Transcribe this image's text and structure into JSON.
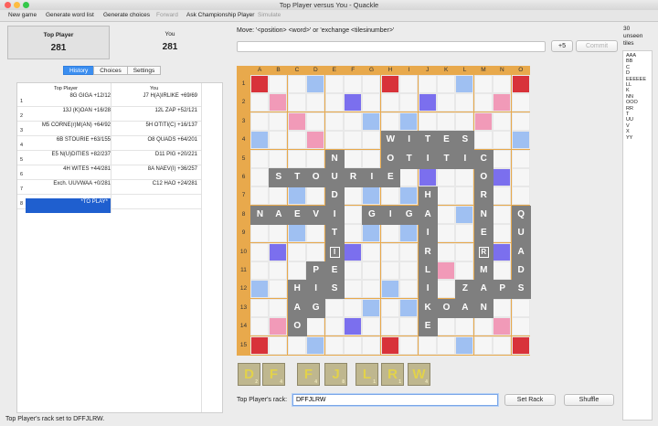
{
  "window": {
    "title": "Top Player versus You - Quackle"
  },
  "toolbar": {
    "new_game": "New game",
    "generate_word_list": "Generate word list",
    "generate_choices": "Generate choices",
    "forward": "Forward",
    "ask_championship": "Ask Championship Player",
    "simulate": "Simulate"
  },
  "scores": {
    "p1_name": "Top Player",
    "p1_score": "281",
    "p2_name": "You",
    "p2_score": "281"
  },
  "tabs": {
    "history": "History",
    "choices": "Choices",
    "settings": "Settings"
  },
  "history": {
    "col1": "Top Player",
    "col2": "You",
    "rows": [
      {
        "n": "1",
        "p1": "8G GIGA  +12/12",
        "p2": "J7 H(A)IRLIKE  +69/69"
      },
      {
        "n": "2",
        "p1": "13J (K)OAN  +16/28",
        "p2": "12L ZAP  +52/121"
      },
      {
        "n": "3",
        "p1": "M5 CORNE(r)M(AN)  +64/92",
        "p2": "5H OTITI(C)  +16/137"
      },
      {
        "n": "4",
        "p1": "6B STOURIE  +63/155",
        "p2": "O8 QUADS  +64/201"
      },
      {
        "n": "5",
        "p1": "E5 N(U)DITIES  +82/237",
        "p2": "D11 PIG  +20/221"
      },
      {
        "n": "6",
        "p1": "4H WITES  +44/281",
        "p2": "8A NAEV(I)  +36/257"
      },
      {
        "n": "7",
        "p1": "Exch. UUVWAA  +0/281",
        "p2": "C12 HAO  +24/281"
      },
      {
        "n": "8",
        "p1": "*TO PLAY*",
        "p2": ""
      }
    ]
  },
  "status": "Top Player's rack set to DFFJLRW.",
  "move": {
    "label": "Move: '<position> <word>' or 'exchange <tilesinumber>'",
    "value": "",
    "plus5": "+5",
    "commit": "Commit"
  },
  "unseen": {
    "label_count": "30",
    "label_word": "unseen",
    "label_tiles": "tiles",
    "lines": [
      "AAA",
      "BB",
      "C",
      "D",
      "EEEEEE",
      "LL",
      "K",
      "NN",
      "OOO",
      "RR",
      "T",
      "UU",
      "V",
      "X",
      "YY"
    ]
  },
  "board": {
    "columns": [
      "A",
      "B",
      "C",
      "D",
      "E",
      "F",
      "G",
      "H",
      "I",
      "J",
      "K",
      "L",
      "M",
      "N",
      "O"
    ],
    "rows": [
      "1",
      "2",
      "3",
      "4",
      "5",
      "6",
      "7",
      "8",
      "9",
      "10",
      "11",
      "12",
      "13",
      "14",
      "15"
    ],
    "colors": {
      "TW": "#d8323a",
      "DW": "#f19ab8",
      "TL": "#7b6fee",
      "DL": "#9fc0f2",
      "plain": "#f6f6f6",
      "tile": "#7f7f7f"
    },
    "premium": {
      "TW": [
        [
          0,
          0
        ],
        [
          0,
          7
        ],
        [
          0,
          14
        ],
        [
          7,
          0
        ],
        [
          7,
          14
        ],
        [
          14,
          0
        ],
        [
          14,
          7
        ],
        [
          14,
          14
        ]
      ],
      "DW": [
        [
          1,
          1
        ],
        [
          2,
          2
        ],
        [
          3,
          3
        ],
        [
          4,
          4
        ],
        [
          1,
          13
        ],
        [
          2,
          12
        ],
        [
          3,
          11
        ],
        [
          4,
          10
        ],
        [
          10,
          4
        ],
        [
          11,
          3
        ],
        [
          12,
          2
        ],
        [
          13,
          1
        ],
        [
          10,
          10
        ],
        [
          11,
          11
        ],
        [
          12,
          12
        ],
        [
          13,
          13
        ]
      ],
      "TL": [
        [
          1,
          5
        ],
        [
          1,
          9
        ],
        [
          5,
          1
        ],
        [
          5,
          5
        ],
        [
          5,
          9
        ],
        [
          5,
          13
        ],
        [
          9,
          1
        ],
        [
          9,
          5
        ],
        [
          9,
          9
        ],
        [
          9,
          13
        ],
        [
          13,
          5
        ],
        [
          13,
          9
        ]
      ],
      "DL": [
        [
          0,
          3
        ],
        [
          0,
          11
        ],
        [
          2,
          6
        ],
        [
          2,
          8
        ],
        [
          3,
          0
        ],
        [
          3,
          7
        ],
        [
          3,
          14
        ],
        [
          6,
          2
        ],
        [
          6,
          6
        ],
        [
          6,
          8
        ],
        [
          6,
          12
        ],
        [
          7,
          3
        ],
        [
          7,
          11
        ],
        [
          8,
          2
        ],
        [
          8,
          6
        ],
        [
          8,
          8
        ],
        [
          8,
          12
        ],
        [
          11,
          0
        ],
        [
          11,
          7
        ],
        [
          11,
          14
        ],
        [
          12,
          6
        ],
        [
          12,
          8
        ],
        [
          14,
          3
        ],
        [
          14,
          11
        ]
      ]
    },
    "tiles": [
      {
        "r": 3,
        "c": 7,
        "ch": "W"
      },
      {
        "r": 3,
        "c": 8,
        "ch": "I"
      },
      {
        "r": 3,
        "c": 9,
        "ch": "T"
      },
      {
        "r": 3,
        "c": 10,
        "ch": "E"
      },
      {
        "r": 3,
        "c": 11,
        "ch": "S"
      },
      {
        "r": 4,
        "c": 4,
        "ch": "N"
      },
      {
        "r": 4,
        "c": 7,
        "ch": "O"
      },
      {
        "r": 4,
        "c": 8,
        "ch": "T"
      },
      {
        "r": 4,
        "c": 9,
        "ch": "I"
      },
      {
        "r": 4,
        "c": 10,
        "ch": "T"
      },
      {
        "r": 4,
        "c": 11,
        "ch": "I"
      },
      {
        "r": 4,
        "c": 12,
        "ch": "C"
      },
      {
        "r": 5,
        "c": 1,
        "ch": "S"
      },
      {
        "r": 5,
        "c": 2,
        "ch": "T"
      },
      {
        "r": 5,
        "c": 3,
        "ch": "O"
      },
      {
        "r": 5,
        "c": 4,
        "ch": "U"
      },
      {
        "r": 5,
        "c": 5,
        "ch": "R"
      },
      {
        "r": 5,
        "c": 6,
        "ch": "I"
      },
      {
        "r": 5,
        "c": 7,
        "ch": "E"
      },
      {
        "r": 5,
        "c": 12,
        "ch": "O"
      },
      {
        "r": 6,
        "c": 4,
        "ch": "D"
      },
      {
        "r": 6,
        "c": 9,
        "ch": "H"
      },
      {
        "r": 6,
        "c": 12,
        "ch": "R"
      },
      {
        "r": 7,
        "c": 0,
        "ch": "N"
      },
      {
        "r": 7,
        "c": 1,
        "ch": "A"
      },
      {
        "r": 7,
        "c": 2,
        "ch": "E"
      },
      {
        "r": 7,
        "c": 3,
        "ch": "V"
      },
      {
        "r": 7,
        "c": 4,
        "ch": "I"
      },
      {
        "r": 7,
        "c": 6,
        "ch": "G"
      },
      {
        "r": 7,
        "c": 7,
        "ch": "I"
      },
      {
        "r": 7,
        "c": 8,
        "ch": "G"
      },
      {
        "r": 7,
        "c": 9,
        "ch": "A"
      },
      {
        "r": 7,
        "c": 12,
        "ch": "N"
      },
      {
        "r": 7,
        "c": 14,
        "ch": "Q"
      },
      {
        "r": 8,
        "c": 4,
        "ch": "T"
      },
      {
        "r": 8,
        "c": 9,
        "ch": "I"
      },
      {
        "r": 8,
        "c": 12,
        "ch": "E"
      },
      {
        "r": 8,
        "c": 14,
        "ch": "U"
      },
      {
        "r": 9,
        "c": 4,
        "ch": "I",
        "blank": true
      },
      {
        "r": 9,
        "c": 9,
        "ch": "R"
      },
      {
        "r": 9,
        "c": 12,
        "ch": "R",
        "blank": true
      },
      {
        "r": 9,
        "c": 14,
        "ch": "A"
      },
      {
        "r": 10,
        "c": 3,
        "ch": "P"
      },
      {
        "r": 10,
        "c": 4,
        "ch": "E"
      },
      {
        "r": 10,
        "c": 9,
        "ch": "L"
      },
      {
        "r": 10,
        "c": 12,
        "ch": "M"
      },
      {
        "r": 10,
        "c": 14,
        "ch": "D"
      },
      {
        "r": 11,
        "c": 2,
        "ch": "H"
      },
      {
        "r": 11,
        "c": 3,
        "ch": "I"
      },
      {
        "r": 11,
        "c": 4,
        "ch": "S"
      },
      {
        "r": 11,
        "c": 9,
        "ch": "I"
      },
      {
        "r": 11,
        "c": 11,
        "ch": "Z"
      },
      {
        "r": 11,
        "c": 12,
        "ch": "A"
      },
      {
        "r": 11,
        "c": 13,
        "ch": "P"
      },
      {
        "r": 11,
        "c": 14,
        "ch": "S"
      },
      {
        "r": 12,
        "c": 2,
        "ch": "A"
      },
      {
        "r": 12,
        "c": 3,
        "ch": "G"
      },
      {
        "r": 12,
        "c": 9,
        "ch": "K"
      },
      {
        "r": 12,
        "c": 10,
        "ch": "O"
      },
      {
        "r": 12,
        "c": 11,
        "ch": "A"
      },
      {
        "r": 12,
        "c": 12,
        "ch": "N"
      },
      {
        "r": 13,
        "c": 2,
        "ch": "O"
      },
      {
        "r": 13,
        "c": 9,
        "ch": "E"
      }
    ]
  },
  "rack": {
    "tiles": [
      {
        "ch": "D",
        "v": "2"
      },
      {
        "ch": "F",
        "v": "4"
      },
      {
        "ch": "F",
        "v": "4"
      },
      {
        "ch": "J",
        "v": "8"
      },
      {
        "ch": "L",
        "v": "1"
      },
      {
        "ch": "R",
        "v": "1"
      },
      {
        "ch": "W",
        "v": "4"
      }
    ],
    "label": "Top Player's rack:",
    "value": "DFFJLRW",
    "set_rack": "Set Rack",
    "shuffle": "Shuffle"
  }
}
